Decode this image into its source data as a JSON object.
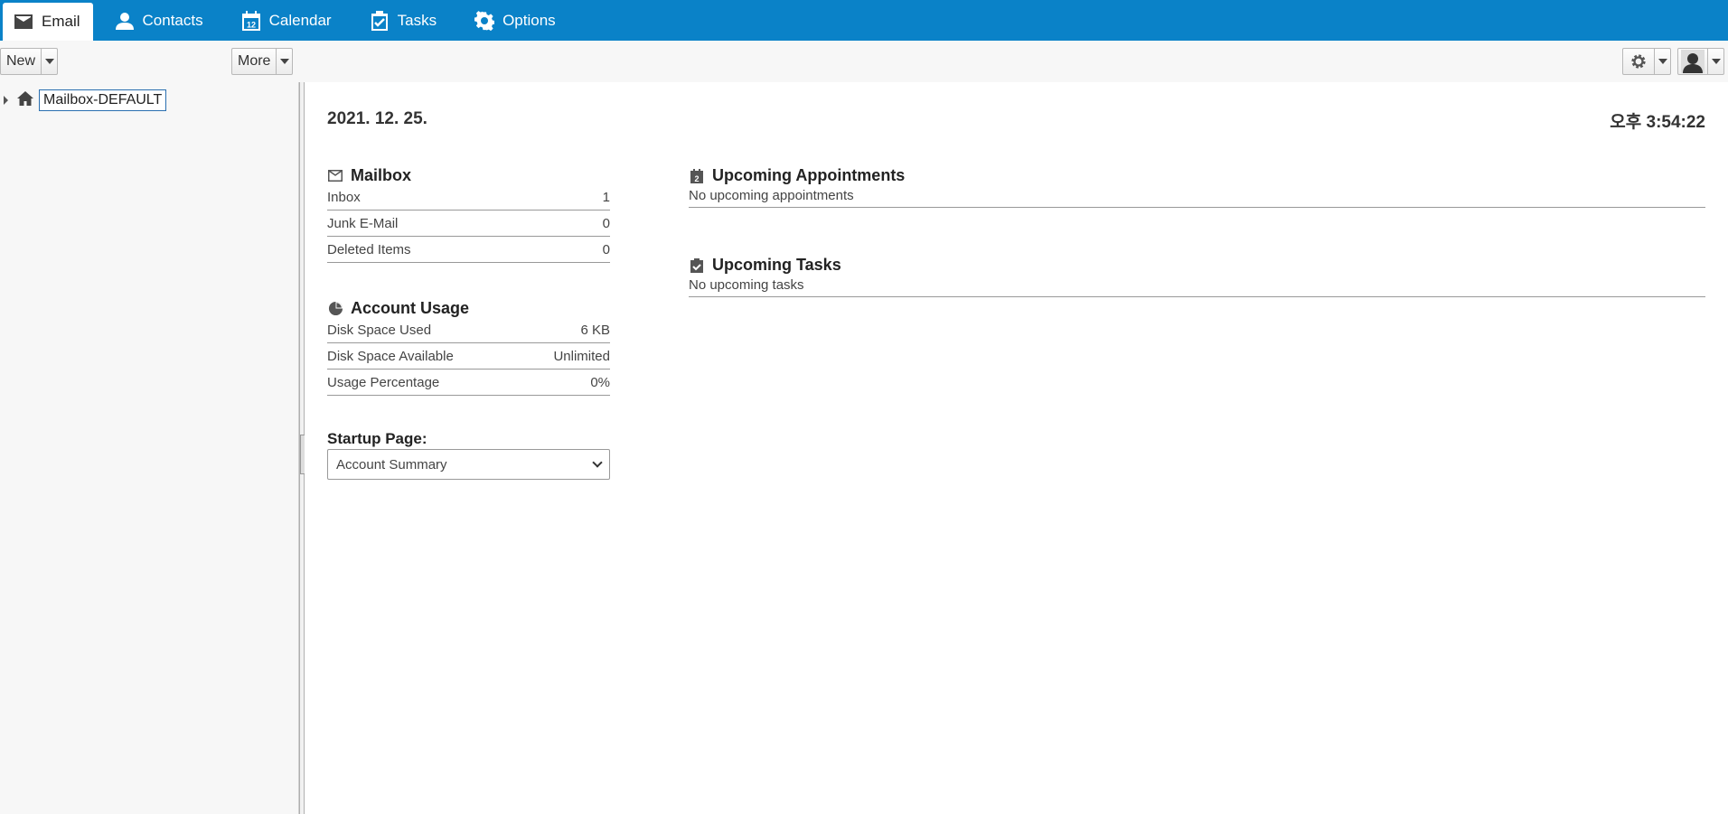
{
  "nav": {
    "tabs": [
      {
        "label": "Email",
        "icon": "envelope-icon",
        "active": true
      },
      {
        "label": "Contacts",
        "icon": "person-icon"
      },
      {
        "label": "Calendar",
        "icon": "calendar-icon",
        "badge": "12"
      },
      {
        "label": "Tasks",
        "icon": "clipboard-icon"
      },
      {
        "label": "Options",
        "icon": "gear-icon"
      }
    ]
  },
  "toolbar": {
    "new_label": "New",
    "more_label": "More"
  },
  "sidebar": {
    "mailbox": "Mailbox-DEFAULT"
  },
  "main": {
    "date": "2021. 12. 25.",
    "time": "오후 3:54:22",
    "mailbox": {
      "title": "Mailbox",
      "rows": [
        {
          "label": "Inbox",
          "value": "1"
        },
        {
          "label": "Junk E-Mail",
          "value": "0"
        },
        {
          "label": "Deleted Items",
          "value": "0"
        }
      ]
    },
    "usage": {
      "title": "Account Usage",
      "rows": [
        {
          "label": "Disk Space Used",
          "value": "6 KB"
        },
        {
          "label": "Disk Space Available",
          "value": "Unlimited"
        },
        {
          "label": "Usage Percentage",
          "value": "0%"
        }
      ]
    },
    "appointments": {
      "title": "Upcoming Appointments",
      "badge": "2",
      "empty": "No upcoming appointments"
    },
    "tasks": {
      "title": "Upcoming Tasks",
      "empty": "No upcoming tasks"
    },
    "startup": {
      "label": "Startup Page:",
      "selected": "Account Summary"
    }
  }
}
